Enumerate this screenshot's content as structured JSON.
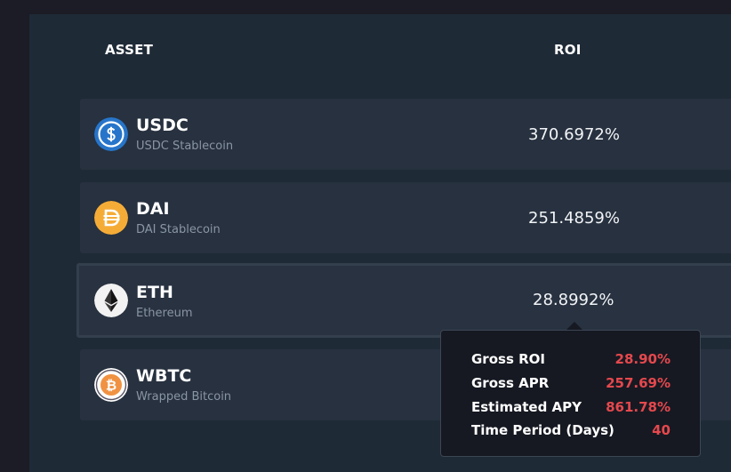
{
  "header": {
    "asset_label": "ASSET",
    "roi_label": "ROI"
  },
  "assets": [
    {
      "symbol": "USDC",
      "name": "USDC Stablecoin",
      "roi": "370.6972%",
      "icon": "usdc-icon",
      "color": "#2775ca"
    },
    {
      "symbol": "DAI",
      "name": "DAI Stablecoin",
      "roi": "251.4859%",
      "icon": "dai-icon",
      "color": "#f5ac37"
    },
    {
      "symbol": "ETH",
      "name": "Ethereum",
      "roi": "28.8992%",
      "icon": "eth-icon",
      "color": "#f2f2f2"
    },
    {
      "symbol": "WBTC",
      "name": "Wrapped Bitcoin",
      "roi": "",
      "icon": "wbtc-icon",
      "color": "#f09242"
    }
  ],
  "tooltip": {
    "rows": [
      {
        "label": "Gross ROI",
        "value": "28.90%"
      },
      {
        "label": "Gross APR",
        "value": "257.69%"
      },
      {
        "label": "Estimated APY",
        "value": "861.78%"
      },
      {
        "label": "Time Period (Days)",
        "value": "40"
      }
    ]
  },
  "colors": {
    "background": "#1b1c25",
    "panel": "#1f2a37",
    "row": "#27313f",
    "tooltip_value": "#e5484d"
  }
}
